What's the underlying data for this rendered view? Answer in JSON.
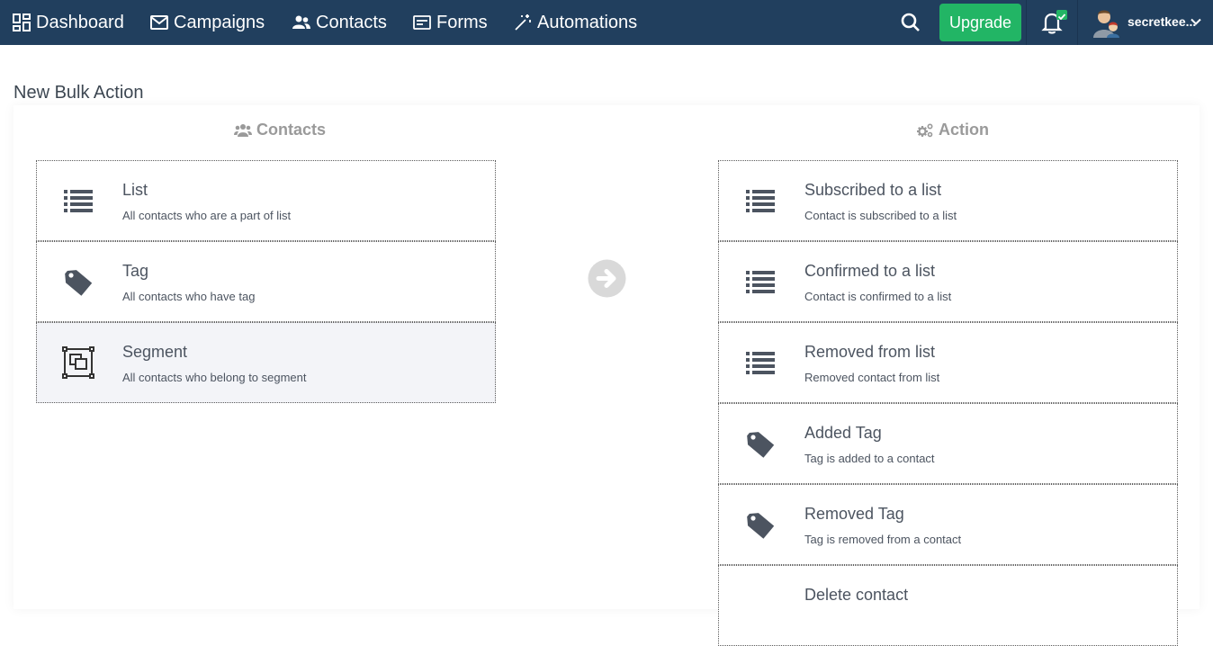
{
  "nav": {
    "dashboard": "Dashboard",
    "campaigns": "Campaigns",
    "contacts": "Contacts",
    "forms": "Forms",
    "automations": "Automations",
    "upgrade": "Upgrade",
    "username": "secretkee..."
  },
  "page": {
    "title": "New Bulk Action"
  },
  "contacts_column": {
    "heading": "Contacts",
    "items": [
      {
        "title": "List",
        "desc": "All contacts who are a part of list",
        "icon": "list-icon"
      },
      {
        "title": "Tag",
        "desc": "All contacts who have tag",
        "icon": "tag-icon"
      },
      {
        "title": "Segment",
        "desc": "All contacts who belong to segment",
        "icon": "segment-icon"
      }
    ]
  },
  "action_column": {
    "heading": "Action",
    "items": [
      {
        "title": "Subscribed to a list",
        "desc": "Contact is subscribed to a list",
        "icon": "list-icon"
      },
      {
        "title": "Confirmed to a list",
        "desc": "Contact is confirmed to a list",
        "icon": "list-icon"
      },
      {
        "title": "Removed from list",
        "desc": "Removed contact from list",
        "icon": "list-icon"
      },
      {
        "title": "Added Tag",
        "desc": "Tag is added to a contact",
        "icon": "tag-icon"
      },
      {
        "title": "Removed Tag",
        "desc": "Tag is removed from a contact",
        "icon": "tag-icon"
      },
      {
        "title": "Delete contact",
        "desc": "",
        "icon": "delete-icon"
      }
    ]
  },
  "colors": {
    "nav_bg": "#213f5e",
    "upgrade_bg": "#22b565",
    "selected_card_bg": "#f3f4f8"
  }
}
